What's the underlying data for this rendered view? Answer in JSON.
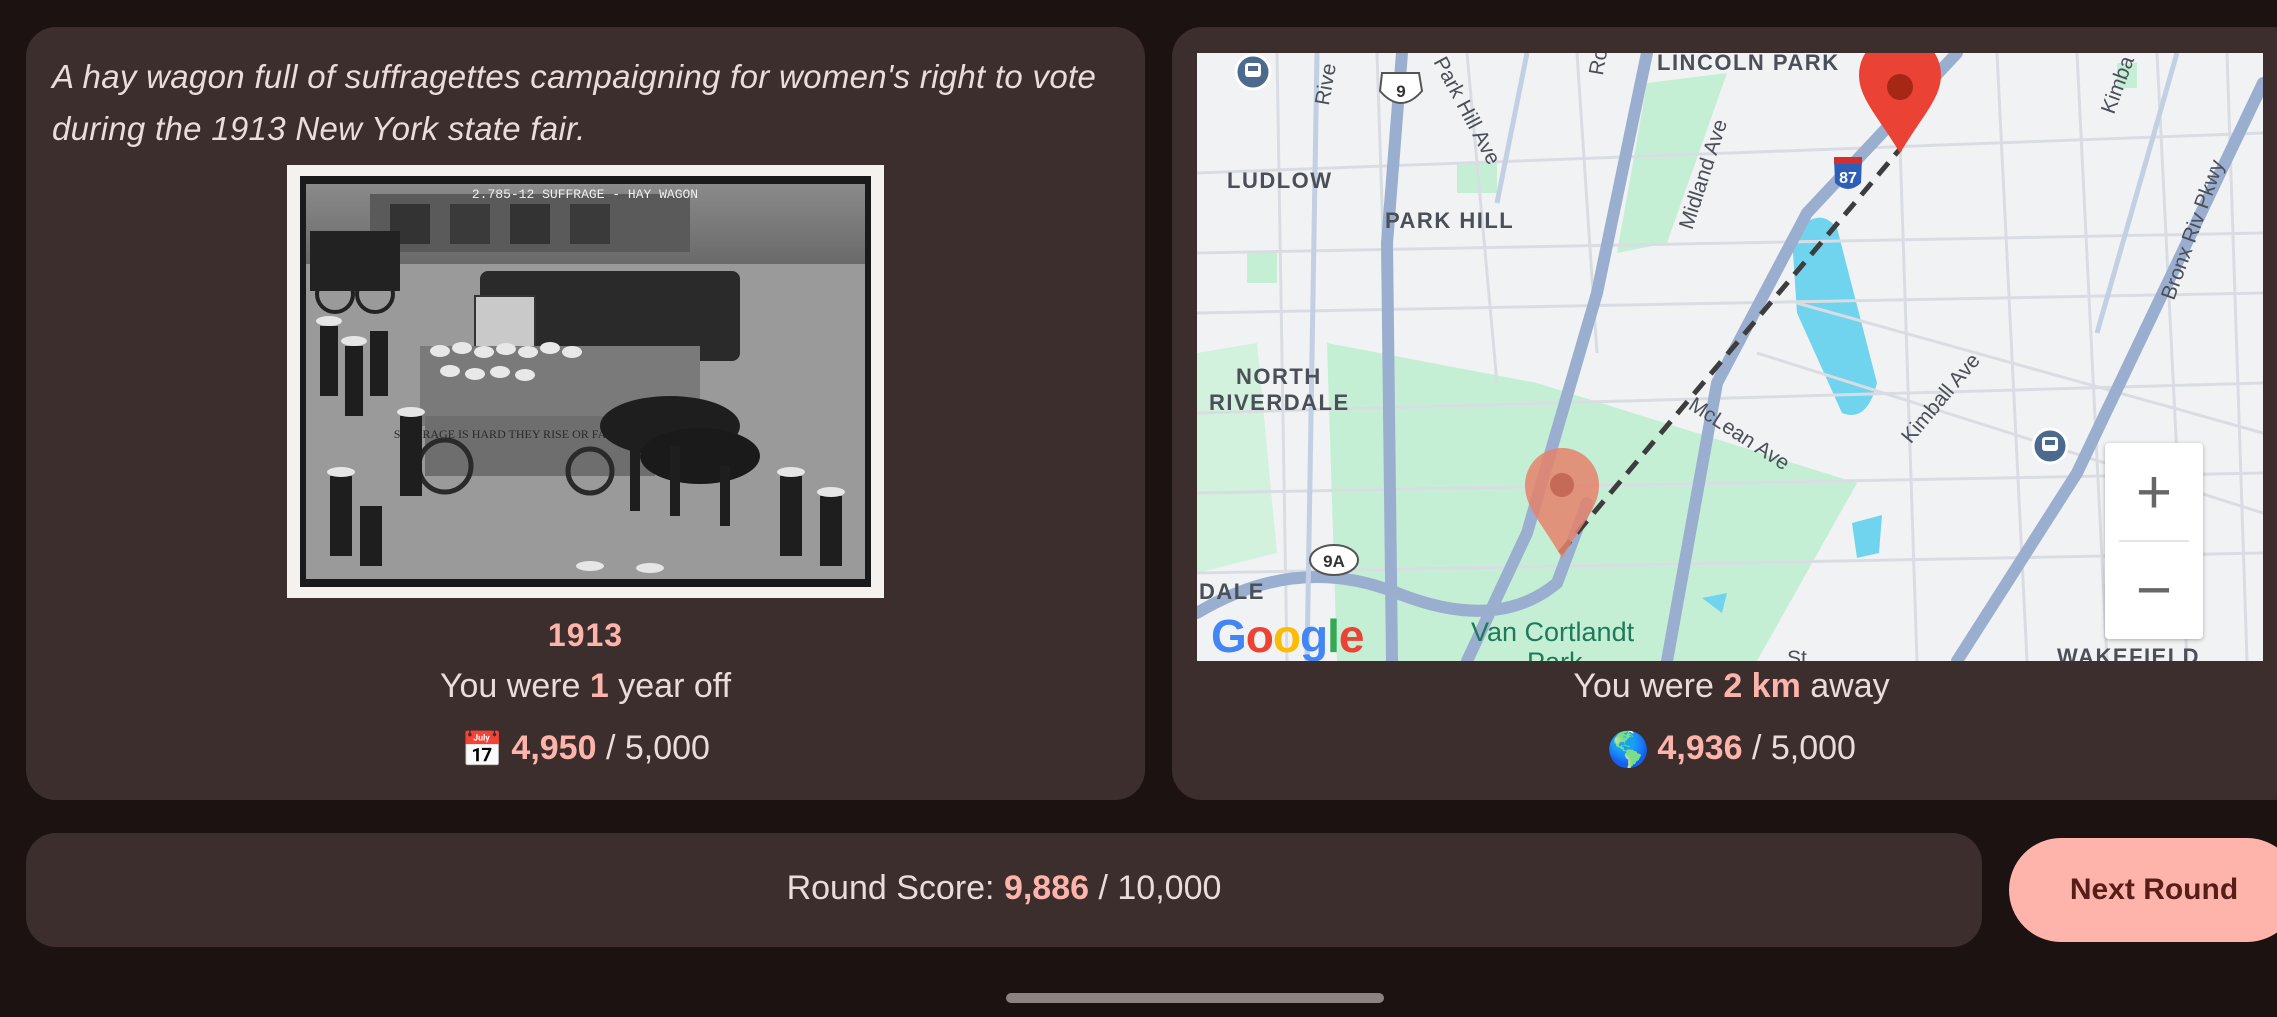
{
  "year_card": {
    "caption": "A hay wagon full of suffragettes campaigning for women's right to vote during the 1913 New York state fair.",
    "photo_inscription": "2.785-12 SUFFRAGE - HAY WAGON",
    "wagon_sign": "SUFFRAGE IS HARD THEY RISE OR FALL TOGETHER",
    "year": "1913",
    "off_prefix": "You were ",
    "off_value": "1",
    "off_suffix": " year off",
    "score_icon": "📅",
    "score": "4,950",
    "score_sep": " / ",
    "score_max": "5,000"
  },
  "map_card": {
    "labels": {
      "lincoln_park": "LINCOLN PARK",
      "ludlow": "LUDLOW",
      "park_hill": "PARK HILL",
      "north": "NORTH",
      "riverdale": "RIVERDALE",
      "dale": "DALE",
      "wakefield": "WAKEFIELD",
      "van_cortlandt": "Van Cortlandt",
      "park": "Park"
    },
    "streets": {
      "park_hill_ave": "Park Hill Ave",
      "midland_ave": "Midland Ave",
      "mclean_ave": "McLean Ave",
      "kimball_ave": "Kimball Ave",
      "bronx_pkwy": "Bronx Riv Pkwy",
      "rive": "Rive",
      "ro": "Ro",
      "kimba": "Kimba",
      "st": "St"
    },
    "shields": {
      "route9": "9",
      "i87": "87",
      "route9a": "9A"
    },
    "google": [
      "G",
      "o",
      "o",
      "g",
      "l",
      "e"
    ],
    "google_colors": [
      "#4285F4",
      "#EA4335",
      "#FBBC05",
      "#4285F4",
      "#34A853",
      "#EA4335"
    ],
    "zoom_in": "+",
    "zoom_out": "−",
    "distance_prefix": "You were ",
    "distance_value": "2 km",
    "distance_suffix": " away",
    "score_icon": "🌎",
    "score": "4,936",
    "score_sep": " / ",
    "score_max": "5,000"
  },
  "round": {
    "label": "Round Score: ",
    "score": "9,886",
    "sep": " / ",
    "max": "10,000"
  },
  "next_button": "Next Round",
  "colors": {
    "background": "#1c1212",
    "card": "#3d2e2e",
    "accent": "#ffb4ab",
    "button_text": "#561e19",
    "actual_pin": "#ea4335",
    "guess_pin": "#e5816b"
  }
}
